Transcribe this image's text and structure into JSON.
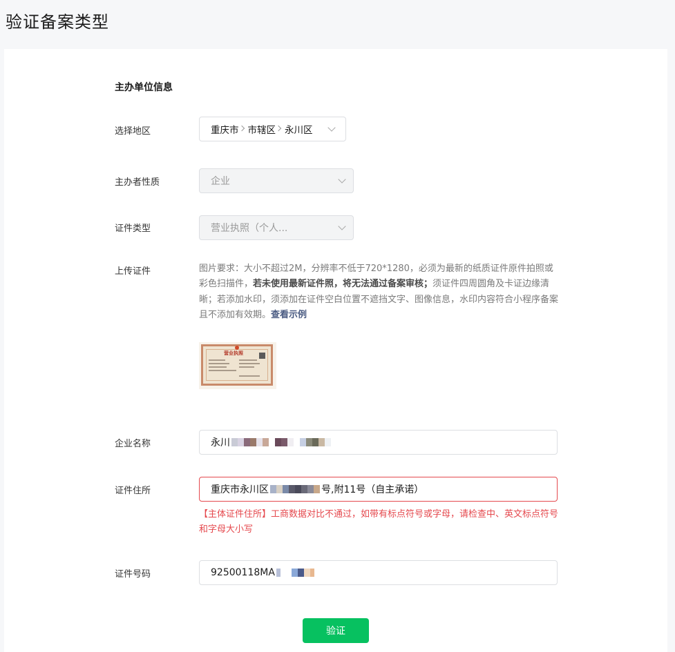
{
  "page_title": "验证备案类型",
  "section_title": "主办单位信息",
  "region": {
    "label": "选择地区",
    "path": [
      "重庆市",
      "市辖区",
      "永川区"
    ]
  },
  "organizer_type": {
    "label": "主办者性质",
    "value": "企业"
  },
  "cert_type": {
    "label": "证件类型",
    "value": "营业执照（个人..."
  },
  "upload": {
    "label": "上传证件",
    "desc_part1": "图片要求：大小不超过2M，分辨率不低于720*1280，必须为最新的纸质证件原件拍照或彩色扫描件，",
    "desc_bold": "若未使用最新证件照，将无法通过备案审核；",
    "desc_part2": "须证件四周圆角及卡证边缘清晰；若添加水印，须添加在证件空白位置不遮挡文字、图像信息，水印内容符合小程序备案且不添加有效期。",
    "example_link": "查看示例",
    "thumbnail_title": "营业执照"
  },
  "company_name": {
    "label": "企业名称",
    "value_prefix": "永川"
  },
  "cert_address": {
    "label": "证件住所",
    "value_prefix": "重庆市永川区",
    "value_suffix": "号,附11号（自主承诺）",
    "error": "【主体证件住所】工商数据对比不通过，如带有标点符号或字母，请检查中、英文标点符号和字母大小写"
  },
  "cert_number": {
    "label": "证件号码",
    "value_prefix": "92500118MA"
  },
  "submit_label": "验证",
  "colors": {
    "accent": "#07c160",
    "error": "#e5484d",
    "link": "#4a5b82"
  }
}
